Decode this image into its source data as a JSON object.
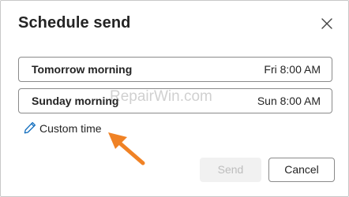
{
  "dialog": {
    "title": "Schedule send",
    "close_icon": "close-icon"
  },
  "options": [
    {
      "label": "Tomorrow morning",
      "time": "Fri 8:00 AM"
    },
    {
      "label": "Sunday morning",
      "time": "Sun 8:00 AM"
    }
  ],
  "custom_time": {
    "label": "Custom time",
    "icon": "pencil-icon"
  },
  "watermark": "RepairWin.com",
  "annotation": {
    "icon": "arrow-pointer-icon",
    "color": "#f08225"
  },
  "buttons": {
    "send_label": "Send",
    "send_enabled": false,
    "cancel_label": "Cancel"
  },
  "colors": {
    "text": "#242424",
    "border": "#8a8a8a",
    "pencil": "#0f6cbd",
    "annotation_arrow": "#f08225",
    "disabled_bg": "#f1f1f1",
    "disabled_text": "#bdbdbd"
  }
}
